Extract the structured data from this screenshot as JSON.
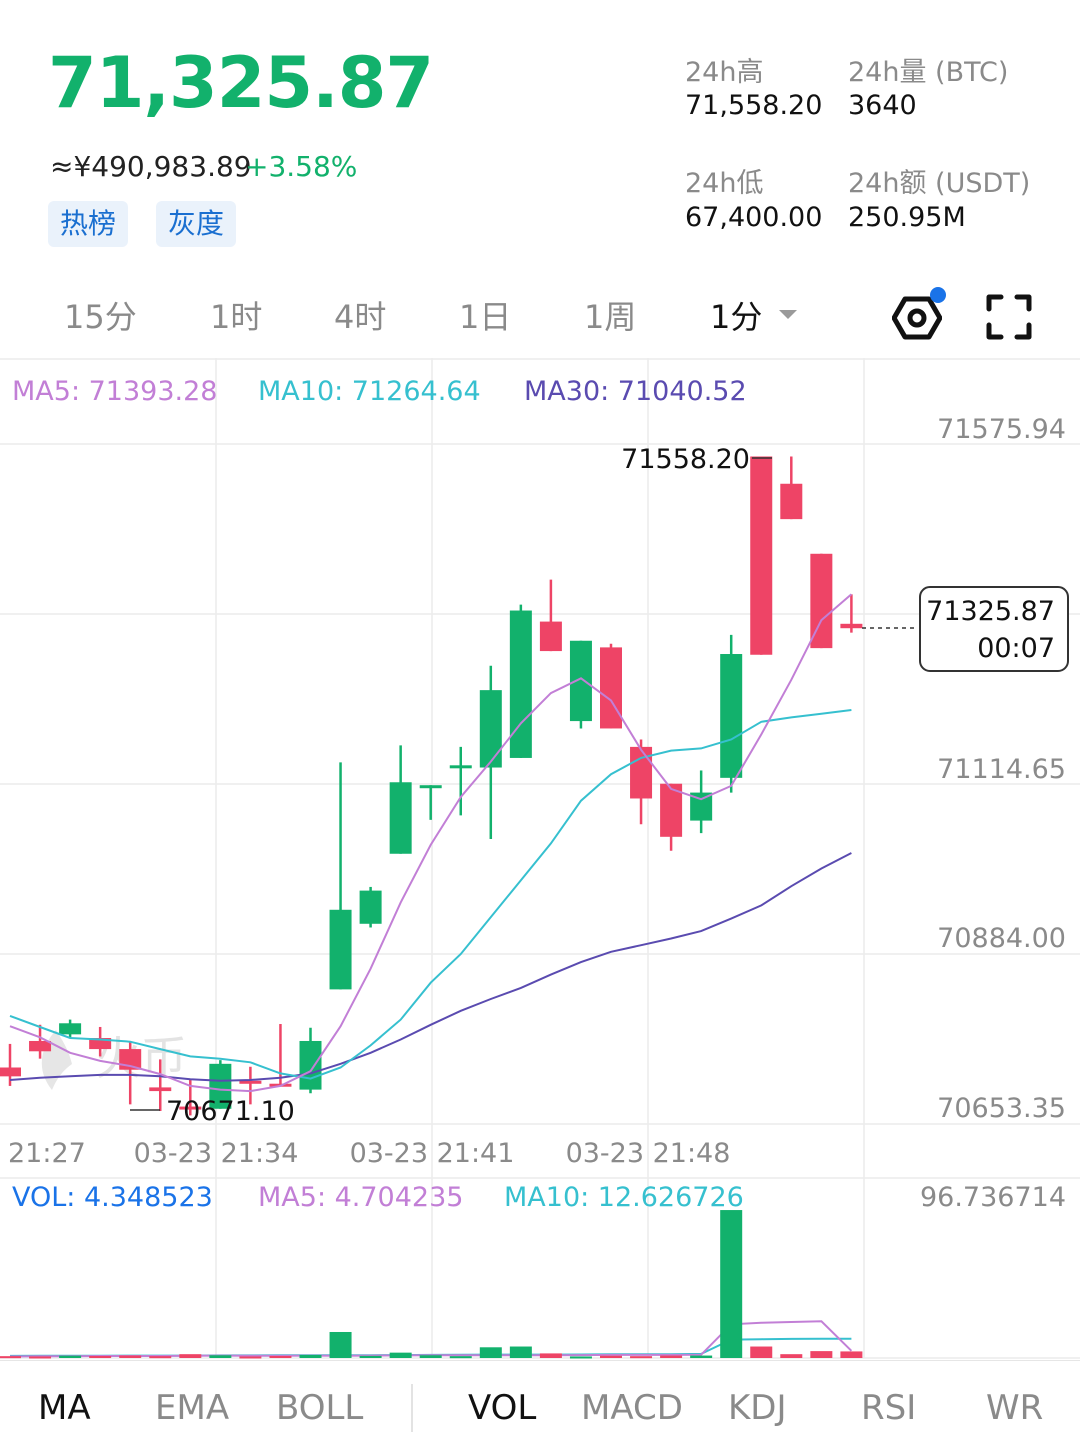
{
  "header": {
    "price": "71,325.87",
    "cny_price": "≈¥490,983.89",
    "change_pct": "+3.58%",
    "tags": [
      "热榜",
      "灰度"
    ],
    "stats": {
      "high_label": "24h高",
      "high_value": "71,558.20",
      "vol_label": "24h量 (BTC)",
      "vol_value": "3640",
      "low_label": "24h低",
      "low_value": "67,400.00",
      "amt_label": "24h额 (USDT)",
      "amt_value": "250.95M"
    }
  },
  "timeframes": [
    "15分",
    "1时",
    "4时",
    "1日",
    "1周",
    "1分"
  ],
  "active_timeframe": "1分",
  "icons": [
    "settings-gear-icon",
    "fullscreen-icon"
  ],
  "colors": {
    "up": "#12b16c",
    "down": "#ee4466",
    "ma5": "#c27fd6",
    "ma10": "#36c0cf",
    "ma30": "#5a4bb0",
    "vol": "#1a73e8"
  },
  "chart_data": {
    "type": "candlestick",
    "ma_labels": {
      "ma5": "MA5: 71393.28",
      "ma10": "MA10: 71264.64",
      "ma30": "MA30: 71040.52"
    },
    "y_ticks": [
      "71575.94",
      "71114.65",
      "70884.00",
      "70653.35"
    ],
    "x_ticks": [
      "21:27",
      "03-23 21:34",
      "03-23 21:41",
      "03-23 21:48"
    ],
    "max_label": "71558.20",
    "min_label": "70671.10",
    "current_price": "71325.87",
    "countdown": "00:07",
    "watermark": "火币",
    "candles": [
      {
        "o": 70730,
        "c": 70718,
        "h": 70762,
        "l": 70705
      },
      {
        "o": 70766,
        "c": 70752,
        "h": 70788,
        "l": 70742
      },
      {
        "o": 70775,
        "c": 70790,
        "h": 70795,
        "l": 70770
      },
      {
        "o": 70770,
        "c": 70755,
        "h": 70785,
        "l": 70745
      },
      {
        "o": 70755,
        "c": 70727,
        "h": 70765,
        "l": 70680
      },
      {
        "o": 70703,
        "c": 70698,
        "h": 70741,
        "l": 70671
      },
      {
        "o": 70677,
        "c": 70674,
        "h": 70713,
        "l": 70665
      },
      {
        "o": 70674,
        "c": 70735,
        "h": 70740,
        "l": 70674
      },
      {
        "o": 70712,
        "c": 70711,
        "h": 70731,
        "l": 70680
      },
      {
        "o": 70708,
        "c": 70704,
        "h": 70789,
        "l": 70704
      },
      {
        "o": 70700,
        "c": 70766,
        "h": 70784,
        "l": 70695
      },
      {
        "o": 70836,
        "c": 70944,
        "h": 71144,
        "l": 70836
      },
      {
        "o": 70925,
        "c": 70970,
        "h": 70975,
        "l": 70920
      },
      {
        "o": 71020,
        "c": 71117,
        "h": 71167,
        "l": 71020
      },
      {
        "o": 71113,
        "c": 71113,
        "h": 71113,
        "l": 71066
      },
      {
        "o": 71140,
        "c": 71140,
        "h": 71165,
        "l": 71072
      },
      {
        "o": 71137,
        "c": 71242,
        "h": 71275,
        "l": 71040
      },
      {
        "o": 71150,
        "c": 71350,
        "h": 71358,
        "l": 71150
      },
      {
        "o": 71335,
        "c": 71295,
        "h": 71392,
        "l": 71295
      },
      {
        "o": 71200,
        "c": 71309,
        "h": 71309,
        "l": 71190
      },
      {
        "o": 71300,
        "c": 71190,
        "h": 71305,
        "l": 71190
      },
      {
        "o": 71165,
        "c": 71095,
        "h": 71175,
        "l": 71060
      },
      {
        "o": 71115,
        "c": 71043,
        "h": 71115,
        "l": 71024
      },
      {
        "o": 71065,
        "c": 71103,
        "h": 71133,
        "l": 71048
      },
      {
        "o": 71123,
        "c": 71291,
        "h": 71317,
        "l": 71103
      },
      {
        "o": 71559,
        "c": 71290,
        "h": 71559,
        "l": 71290
      },
      {
        "o": 71522,
        "c": 71474,
        "h": 71559,
        "l": 71474
      },
      {
        "o": 71427,
        "c": 71299,
        "h": 71427,
        "l": 71299
      },
      {
        "o": 71332,
        "c": 71326,
        "h": 71372,
        "l": 71320
      }
    ],
    "ma5_series": [
      70786,
      70771,
      70750,
      70739,
      70732,
      70721,
      70705,
      70700,
      70698,
      70705,
      70725,
      70786,
      70864,
      70954,
      71032,
      71097,
      71145,
      71197,
      71238,
      71258,
      71228,
      71161,
      71108,
      71094,
      71112,
      71182,
      71256,
      71337,
      71372
    ],
    "ma10_series": [
      70800,
      70785,
      70770,
      70768,
      70765,
      70755,
      70745,
      70742,
      70737,
      70722,
      70715,
      70730,
      70760,
      70795,
      70845,
      70884,
      70934,
      70984,
      71034,
      71092,
      71128,
      71150,
      71160,
      71163,
      71175,
      71199,
      71205,
      71210,
      71215
    ],
    "ma30_series": [
      70713,
      70716,
      70718,
      70720,
      70720,
      70718,
      70714,
      70712,
      70713,
      70716,
      70722,
      70735,
      70750,
      70768,
      70788,
      70807,
      70823,
      70838,
      70856,
      70873,
      70887,
      70896,
      70905,
      70915,
      70932,
      70950,
      70976,
      71000,
      71021
    ],
    "volume": {
      "vol_label": "VOL: 4.348523",
      "ma5_label": "MA5: 4.704235",
      "ma10_label": "MA10: 12.626726",
      "max_label": "96.736714",
      "max": 96.736714,
      "values": [
        1.2,
        1.0,
        1.5,
        1.3,
        1.6,
        1.2,
        2.5,
        1.8,
        1.0,
        1.3,
        2.0,
        17.0,
        1.4,
        3.5,
        1.8,
        1.2,
        7.0,
        7.5,
        3.0,
        1.0,
        1.5,
        1.2,
        1.6,
        1.6,
        96.7,
        7.5,
        2.5,
        4.5,
        4.3
      ],
      "ma5_series": [
        1.0,
        1.1,
        1.2,
        1.3,
        1.3,
        1.3,
        1.5,
        1.6,
        1.5,
        1.5,
        1.6,
        1.5,
        1.6,
        1.7,
        1.8,
        1.8,
        1.8,
        1.8,
        1.8,
        1.9,
        2.0,
        2.0,
        2.0,
        2.1,
        22.0,
        23.0,
        23.5,
        24.0,
        4.7
      ],
      "ma10_series": [
        1.4,
        1.5,
        1.5,
        1.5,
        1.6,
        1.6,
        1.6,
        1.7,
        1.7,
        1.8,
        1.8,
        1.8,
        1.8,
        1.9,
        2.0,
        2.1,
        2.2,
        2.2,
        2.2,
        2.3,
        2.4,
        2.4,
        2.5,
        2.7,
        12.0,
        12.3,
        12.5,
        12.6,
        12.6
      ]
    }
  },
  "indicators": {
    "main": [
      "MA",
      "EMA",
      "BOLL"
    ],
    "sub": [
      "VOL",
      "MACD",
      "KDJ",
      "RSI",
      "WR"
    ],
    "active_main": "MA",
    "active_sub": "VOL"
  }
}
